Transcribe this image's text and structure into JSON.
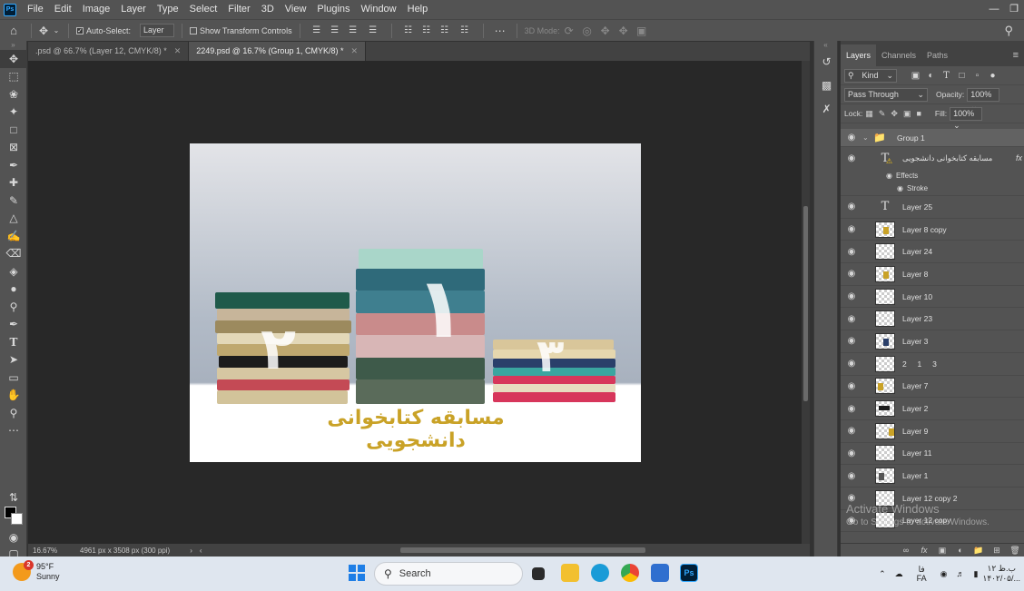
{
  "menubar": {
    "logo": "Ps",
    "items": [
      "File",
      "Edit",
      "Image",
      "Layer",
      "Type",
      "Select",
      "Filter",
      "3D",
      "View",
      "Plugins",
      "Window",
      "Help"
    ]
  },
  "options": {
    "auto_select_label": "Auto-Select:",
    "auto_select_target": "Layer",
    "show_transform_label": "Show Transform Controls",
    "mode_3d_label": "3D Mode:"
  },
  "tabs": [
    {
      "label": ".psd @ 66.7% (Layer 12, CMYK/8) *",
      "active": false
    },
    {
      "label": "2249.psd @ 16.7% (Group 1, CMYK/8) *",
      "active": true
    }
  ],
  "document": {
    "title_text": "مسابقه کتابخوانی دانشجویی",
    "numbers": [
      "۱",
      "۲",
      "۳"
    ]
  },
  "status": {
    "zoom": "16.67%",
    "doc_info": "4961 px x 3508 px (300 ppi)"
  },
  "panel": {
    "tabs": [
      "Layers",
      "Channels",
      "Paths"
    ],
    "filter_kind": "Kind",
    "blend_mode": "Pass Through",
    "opacity_label": "Opacity:",
    "opacity": "100%",
    "lock_label": "Lock:",
    "fill_label": "Fill:",
    "fill": "100%",
    "layers": [
      {
        "name": "Group 1",
        "kind": "group"
      },
      {
        "name": "مسابقه کتابخوانی دانشجویی",
        "kind": "text-fx"
      },
      {
        "name": "Layer 25",
        "kind": "text"
      },
      {
        "name": "Layer 8 copy",
        "kind": "image"
      },
      {
        "name": "Layer 24",
        "kind": "image"
      },
      {
        "name": "Layer 8",
        "kind": "image"
      },
      {
        "name": "Layer 10",
        "kind": "image"
      },
      {
        "name": "Layer 23",
        "kind": "image"
      },
      {
        "name": "Layer 3",
        "kind": "image"
      },
      {
        "name": "2     1     3",
        "kind": "image"
      },
      {
        "name": "Layer 7",
        "kind": "image"
      },
      {
        "name": "Layer 2",
        "kind": "image"
      },
      {
        "name": "Layer 9",
        "kind": "image"
      },
      {
        "name": "Layer 11",
        "kind": "image"
      },
      {
        "name": "Layer 1",
        "kind": "image"
      },
      {
        "name": "Layer 12 copy 2",
        "kind": "image"
      },
      {
        "name": "Layer 12 copy",
        "kind": "image"
      }
    ],
    "effects_label": "Effects",
    "stroke_label": "Stroke",
    "fx_label": "fx"
  },
  "watermark": {
    "line1": "Activate Windows",
    "line2": "Go to Settings to activate Windows."
  },
  "taskbar": {
    "temperature": "95°F",
    "condition": "Sunny",
    "badge": "2",
    "search_placeholder": "Search",
    "lang": "FA",
    "lang_prefix": "فا",
    "time": "۱۲ ب.ظ",
    "date": "۱۴۰۲/۰۵/..."
  },
  "colors": {
    "title_gold": "#c9a227",
    "ps_blue": "#31a8ff"
  }
}
